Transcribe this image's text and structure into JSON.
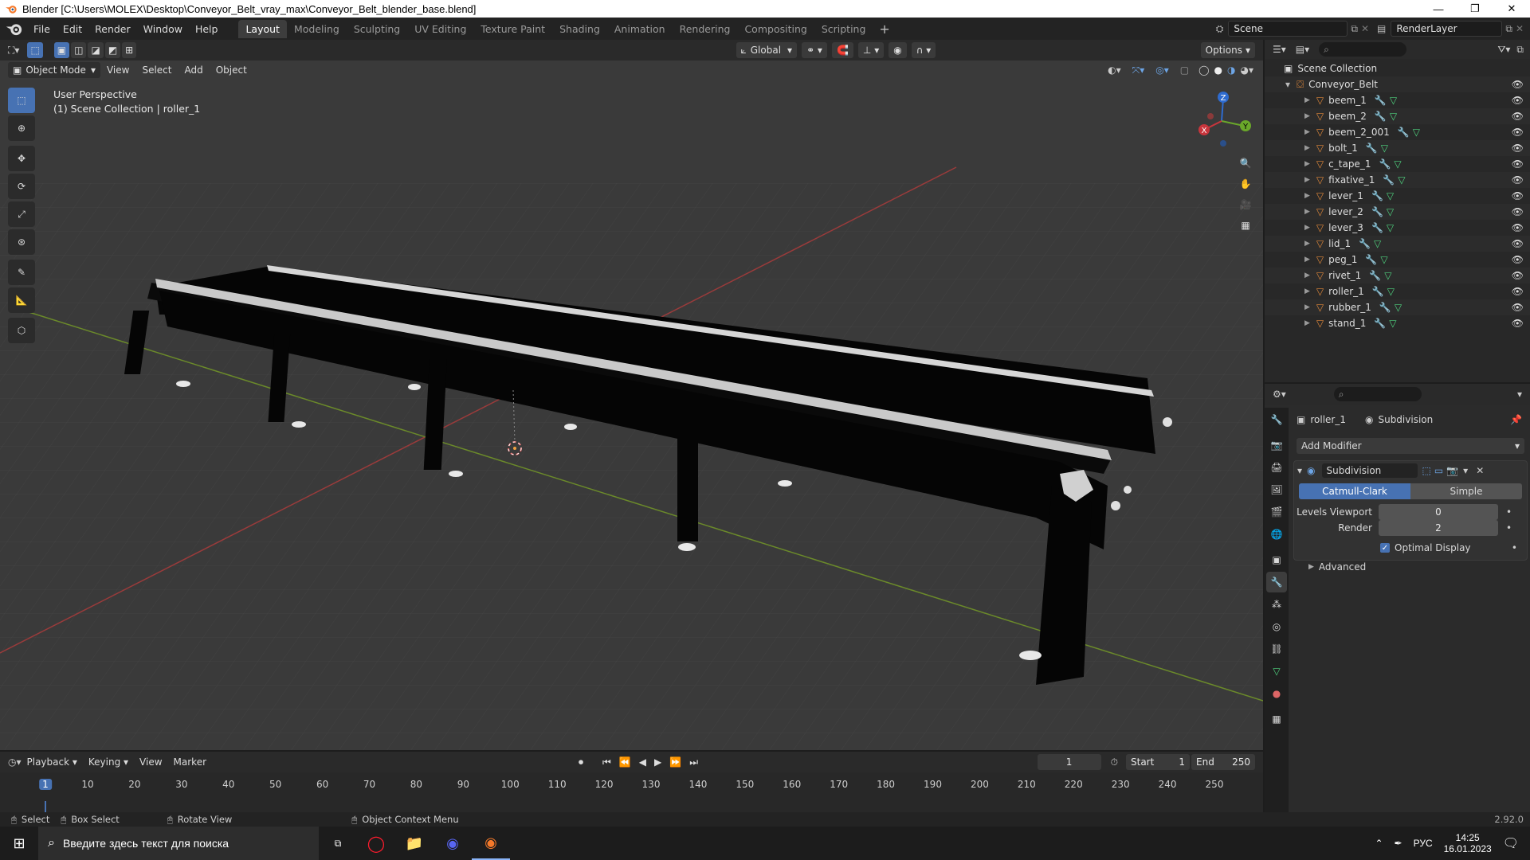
{
  "window": {
    "title": "Blender [C:\\Users\\MOLEX\\Desktop\\Conveyor_Belt_vray_max\\Conveyor_Belt_blender_base.blend]",
    "minimize": "—",
    "maximize": "❐",
    "close": "✕"
  },
  "menu": [
    "File",
    "Edit",
    "Render",
    "Window",
    "Help"
  ],
  "workspaces": [
    {
      "label": "Layout",
      "active": true
    },
    {
      "label": "Modeling"
    },
    {
      "label": "Sculpting"
    },
    {
      "label": "UV Editing"
    },
    {
      "label": "Texture Paint"
    },
    {
      "label": "Shading"
    },
    {
      "label": "Animation"
    },
    {
      "label": "Rendering"
    },
    {
      "label": "Compositing"
    },
    {
      "label": "Scripting"
    }
  ],
  "workspace_add": "+",
  "scene": {
    "name": "Scene",
    "view_layer": "RenderLayer"
  },
  "viewport": {
    "mode": "Object Mode",
    "menus": [
      "View",
      "Select",
      "Add",
      "Object"
    ],
    "orientation": "Global",
    "options": "Options",
    "perspective": "User Perspective",
    "collection_info": "(1) Scene Collection | roller_1",
    "gizmo": {
      "x": "X",
      "y": "Y",
      "z": "Z"
    }
  },
  "outliner": {
    "root": "Scene Collection",
    "collection": "Conveyor_Belt",
    "objects": [
      "beem_1",
      "beem_2",
      "beem_2_001",
      "bolt_1",
      "c_tape_1",
      "fixative_1",
      "lever_1",
      "lever_2",
      "lever_3",
      "lid_1",
      "peg_1",
      "rivet_1",
      "roller_1",
      "rubber_1",
      "stand_1"
    ],
    "active": "roller_1"
  },
  "properties": {
    "object": "roller_1",
    "modifier_context": "Subdivision",
    "add_modifier": "Add Modifier",
    "modifier_name": "Subdivision",
    "type_options": [
      "Catmull-Clark",
      "Simple"
    ],
    "type_selected": "Catmull-Clark",
    "levels_viewport_label": "Levels Viewport",
    "levels_viewport": "0",
    "render_label": "Render",
    "render": "2",
    "optimal_display": "Optimal Display",
    "optimal_display_checked": true,
    "advanced": "Advanced"
  },
  "timeline": {
    "menus": [
      "Playback",
      "Keying",
      "View",
      "Marker"
    ],
    "current_frame": "1",
    "start_label": "Start",
    "start": "1",
    "end_label": "End",
    "end": "250",
    "ticks": [
      "1",
      "10",
      "20",
      "30",
      "40",
      "50",
      "60",
      "70",
      "80",
      "90",
      "100",
      "110",
      "120",
      "130",
      "140",
      "150",
      "160",
      "170",
      "180",
      "190",
      "200",
      "210",
      "220",
      "230",
      "240",
      "250"
    ]
  },
  "status": {
    "select": "Select",
    "box_select": "Box Select",
    "rotate": "Rotate View",
    "context": "Object Context Menu",
    "version": "2.92.0"
  },
  "taskbar": {
    "search_placeholder": "Введите здесь текст для поиска",
    "lang": "РУС",
    "time": "14:25",
    "date": "16.01.2023"
  },
  "colors": {
    "accent": "#4772b3",
    "object_orange": "#e0883a",
    "mesh_green": "#4fd37f",
    "wrench_blue": "#6da5e6",
    "active_frame": "#4772b3"
  }
}
